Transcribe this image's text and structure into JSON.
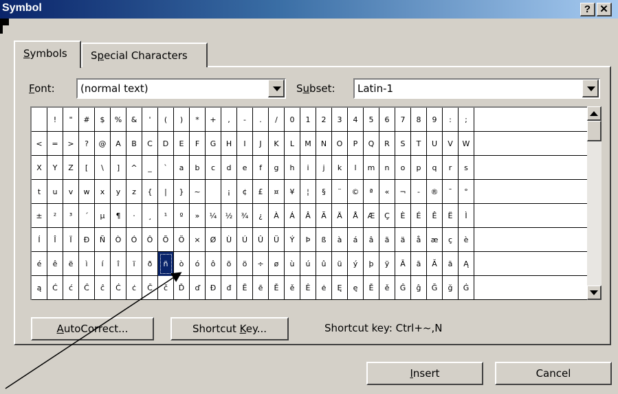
{
  "window": {
    "title": "Symbol",
    "help_label": "?",
    "close_label": "✕"
  },
  "tabs": [
    {
      "label": "Symbols",
      "mnemonic": "S",
      "rest": "ymbols",
      "active": true
    },
    {
      "label": "Special Characters",
      "pre": "S",
      "mnemonic": "p",
      "rest": "ecial Characters",
      "active": false
    }
  ],
  "font": {
    "label_mn": "F",
    "label_rest": "ont:",
    "value": "(normal text)"
  },
  "subset": {
    "label_pre": "S",
    "label_mn": "u",
    "label_rest": "bset:",
    "value": "Latin-1"
  },
  "symbols": [
    [
      " ",
      "!",
      "\"",
      "#",
      "$",
      "%",
      "&",
      "'",
      "(",
      ")",
      "*",
      "+",
      ",",
      "-",
      ".",
      "/",
      "0",
      "1",
      "2",
      "3",
      "4",
      "5",
      "6",
      "7",
      "8",
      "9",
      ":",
      ";"
    ],
    [
      "<",
      "=",
      ">",
      "?",
      "@",
      "A",
      "B",
      "C",
      "D",
      "E",
      "F",
      "G",
      "H",
      "I",
      "J",
      "K",
      "L",
      "M",
      "N",
      "O",
      "P",
      "Q",
      "R",
      "S",
      "T",
      "U",
      "V",
      "W"
    ],
    [
      "X",
      "Y",
      "Z",
      "[",
      "\\",
      "]",
      "^",
      "_",
      "`",
      "a",
      "b",
      "c",
      "d",
      "e",
      "f",
      "g",
      "h",
      "i",
      "j",
      "k",
      "l",
      "m",
      "n",
      "o",
      "p",
      "q",
      "r",
      "s"
    ],
    [
      "t",
      "u",
      "v",
      "w",
      "x",
      "y",
      "z",
      "{",
      "|",
      "}",
      "~",
      " ",
      "¡",
      "¢",
      "£",
      "¤",
      "¥",
      "¦",
      "§",
      "¨",
      "©",
      "ª",
      "«",
      "¬",
      "-",
      "®",
      "¯",
      "°"
    ],
    [
      "±",
      "²",
      "³",
      "´",
      "µ",
      "¶",
      "·",
      "¸",
      "¹",
      "º",
      "»",
      "¼",
      "½",
      "¾",
      "¿",
      "À",
      "Á",
      "Â",
      "Ã",
      "Ä",
      "Å",
      "Æ",
      "Ç",
      "È",
      "É",
      "Ê",
      "Ë",
      "Ì"
    ],
    [
      "Í",
      "Î",
      "Ï",
      "Ð",
      "Ñ",
      "Ò",
      "Ó",
      "Ô",
      "Õ",
      "Ö",
      "×",
      "Ø",
      "Ù",
      "Ú",
      "Û",
      "Ü",
      "Ý",
      "Þ",
      "ß",
      "à",
      "á",
      "â",
      "ã",
      "ä",
      "å",
      "æ",
      "ç",
      "è"
    ],
    [
      "é",
      "ê",
      "ë",
      "ì",
      "í",
      "î",
      "ï",
      "ð",
      "ñ",
      "ò",
      "ó",
      "ô",
      "õ",
      "ö",
      "÷",
      "ø",
      "ù",
      "ú",
      "û",
      "ü",
      "ý",
      "þ",
      "ÿ",
      "Ā",
      "ā",
      "Ă",
      "ă",
      "Ą"
    ],
    [
      "ą",
      "Ć",
      "ć",
      "Ĉ",
      "ĉ",
      "Ċ",
      "ċ",
      "Č",
      "č",
      "Ď",
      "ď",
      "Đ",
      "đ",
      "Ē",
      "ē",
      "Ě",
      "ě",
      "Ė",
      "ė",
      "Ę",
      "ę",
      "Ě",
      "ě",
      "Ĝ",
      "ĝ",
      "Ğ",
      "ğ",
      "Ġ"
    ]
  ],
  "selected_symbol": "ñ",
  "buttons": {
    "autocorrect": {
      "mnemonic": "A",
      "rest": "utoCorrect..."
    },
    "shortcut": {
      "pre": "Shortcut ",
      "mnemonic": "K",
      "rest": "ey..."
    },
    "insert": {
      "mnemonic": "I",
      "rest": "nsert"
    },
    "cancel": "Cancel"
  },
  "shortcut_text": "Shortcut key:  Ctrl+~,N",
  "colors": {
    "title_start": "#0a246a",
    "title_end": "#a6caf0",
    "face": "#d4d0c8",
    "selection": "#0a246a"
  }
}
